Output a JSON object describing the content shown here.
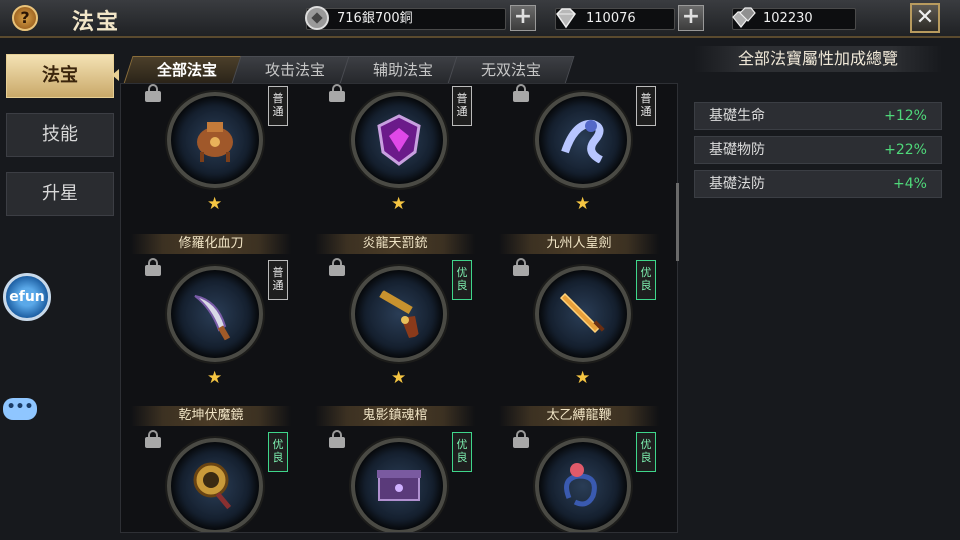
{
  "header": {
    "help_symbol": "?",
    "title": "法宝",
    "currencies": [
      {
        "icon": "coin-icon",
        "value": "716銀700銅"
      },
      {
        "icon": "diamond-icon",
        "value": "110076"
      },
      {
        "icon": "gem-stack-icon",
        "value": "102230"
      }
    ],
    "plus_symbol": "+",
    "close_symbol": "✕"
  },
  "side_tabs": [
    {
      "label": "法宝",
      "active": true
    },
    {
      "label": "技能",
      "active": false
    },
    {
      "label": "升星",
      "active": false
    }
  ],
  "efun_label": "efun",
  "chat_label": "•••",
  "tabs": [
    {
      "label": "全部法宝",
      "active": true
    },
    {
      "label": "攻击法宝",
      "active": false
    },
    {
      "label": "辅助法宝",
      "active": false
    },
    {
      "label": "无双法宝",
      "active": false
    }
  ],
  "items": [
    {
      "name": "",
      "grade": "普通",
      "grade_type": "normal",
      "stars": "★",
      "art": "censer"
    },
    {
      "name": "",
      "grade": "普通",
      "grade_type": "normal",
      "stars": "★",
      "art": "shield"
    },
    {
      "name": "",
      "grade": "普通",
      "grade_type": "normal",
      "stars": "★",
      "art": "ribbon"
    },
    {
      "name": "修羅化血刀",
      "grade": "普通",
      "grade_type": "normal",
      "stars": "★",
      "art": "blade"
    },
    {
      "name": "炎龍天罰銃",
      "grade": "优良",
      "grade_type": "good",
      "stars": "★",
      "art": "gun"
    },
    {
      "name": "九州人皇劍",
      "grade": "优良",
      "grade_type": "good",
      "stars": "★",
      "art": "sword"
    },
    {
      "name": "乾坤伏魔鏡",
      "grade": "优良",
      "grade_type": "good",
      "stars": "",
      "art": "mirror"
    },
    {
      "name": "鬼影鎮魂棺",
      "grade": "优良",
      "grade_type": "good",
      "stars": "",
      "art": "coffin"
    },
    {
      "name": "太乙縛龍鞭",
      "grade": "优良",
      "grade_type": "good",
      "stars": "",
      "art": "whip"
    }
  ],
  "bonus": {
    "title": "全部法寶屬性加成總覽",
    "rows": [
      {
        "label": "基礎生命",
        "value": "+12%"
      },
      {
        "label": "基礎物防",
        "value": "+22%"
      },
      {
        "label": "基礎法防",
        "value": "+4%"
      }
    ]
  },
  "colors": {
    "accent_gold": "#e7cf94",
    "good_grade": "#3fd68b",
    "bonus_value": "#4fd87a"
  }
}
